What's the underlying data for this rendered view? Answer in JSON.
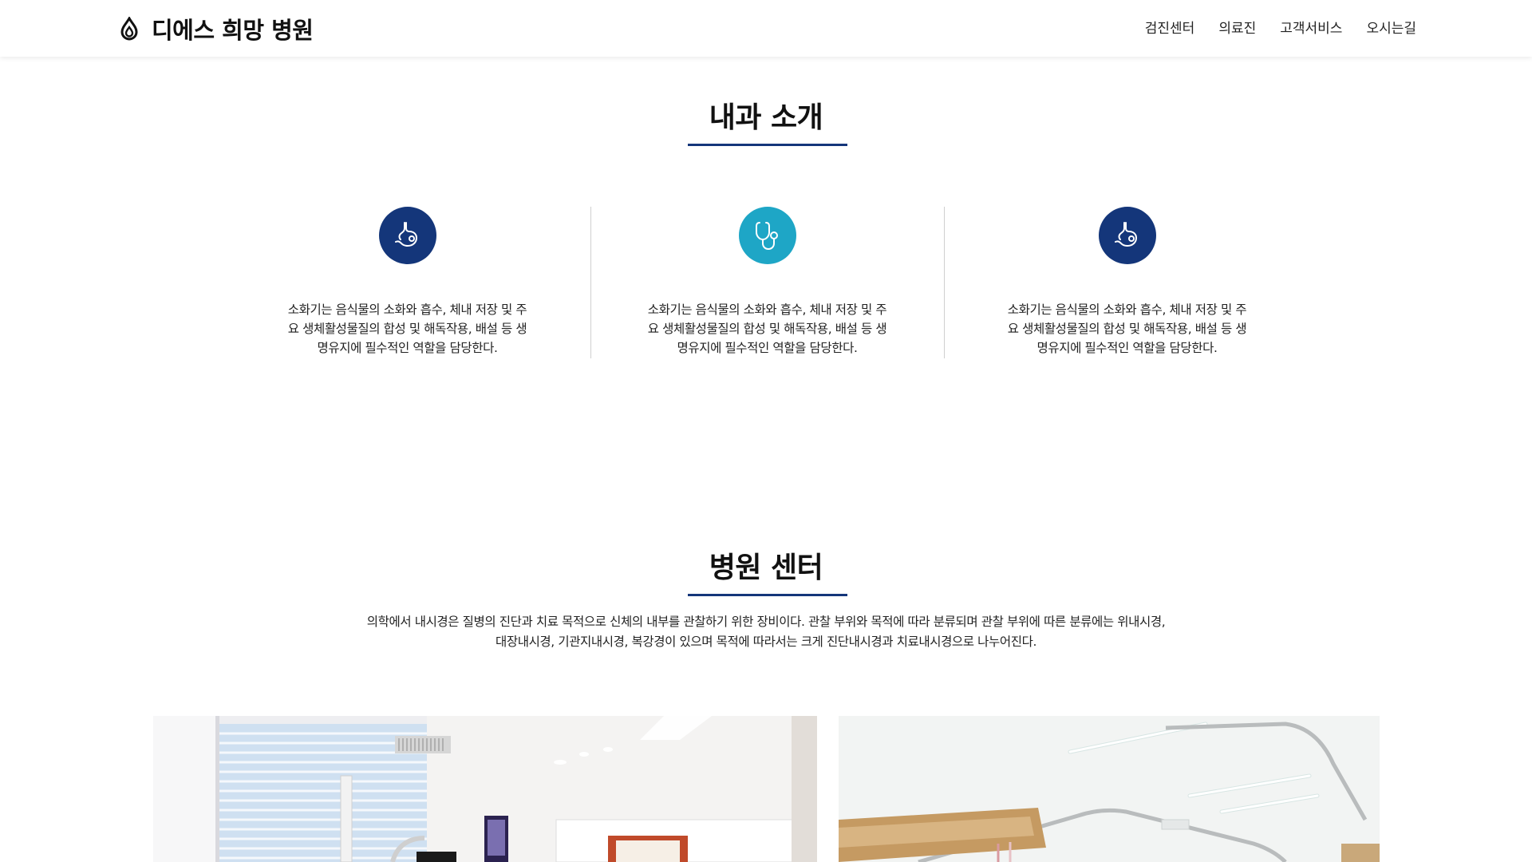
{
  "header": {
    "logo_text": "디에스 희망 병원",
    "logo_icon": "droplet-icon",
    "nav": [
      "검진센터",
      "의료진",
      "고객서비스",
      "오시는길"
    ]
  },
  "intro": {
    "title": "내과 소개",
    "items": [
      {
        "icon": "stomach-icon",
        "icon_color": "#14367a",
        "text": "소화기는 음식물의 소화와 흡수, 체내 저장 및 주요 생체활성물질의 합성 및 해독작용, 배설 등 생명유지에 필수적인 역할을 담당한다."
      },
      {
        "icon": "stethoscope-icon",
        "icon_color": "#1ea6c6",
        "text": "소화기는 음식물의 소화와 흡수, 체내 저장 및 주요 생체활성물질의 합성 및 해독작용, 배설 등 생명유지에 필수적인 역할을 담당한다."
      },
      {
        "icon": "stomach-icon",
        "icon_color": "#14367a",
        "text": "소화기는 음식물의 소화와 흡수, 체내 저장 및 주요 생체활성물질의 합성 및 해독작용, 배설 등 생명유지에 필수적인 역할을 담당한다."
      }
    ]
  },
  "center": {
    "title": "병원 센터",
    "description": "의학에서 내시경은 질병의 진단과 치료 목적으로 신체의 내부를 관찰하기 위한 장비이다. 관찰 부위와 목적에 따라 분류되며 관찰 부위에 따른 분류에는 위내시경, 대장내시경, 기관지내시경, 복강경이 있으며 목적에 따라서는 크게 진단내시경과 치료내시경으로 나누어진다."
  },
  "colors": {
    "accent": "#14367a",
    "teal": "#1ea6c6"
  }
}
